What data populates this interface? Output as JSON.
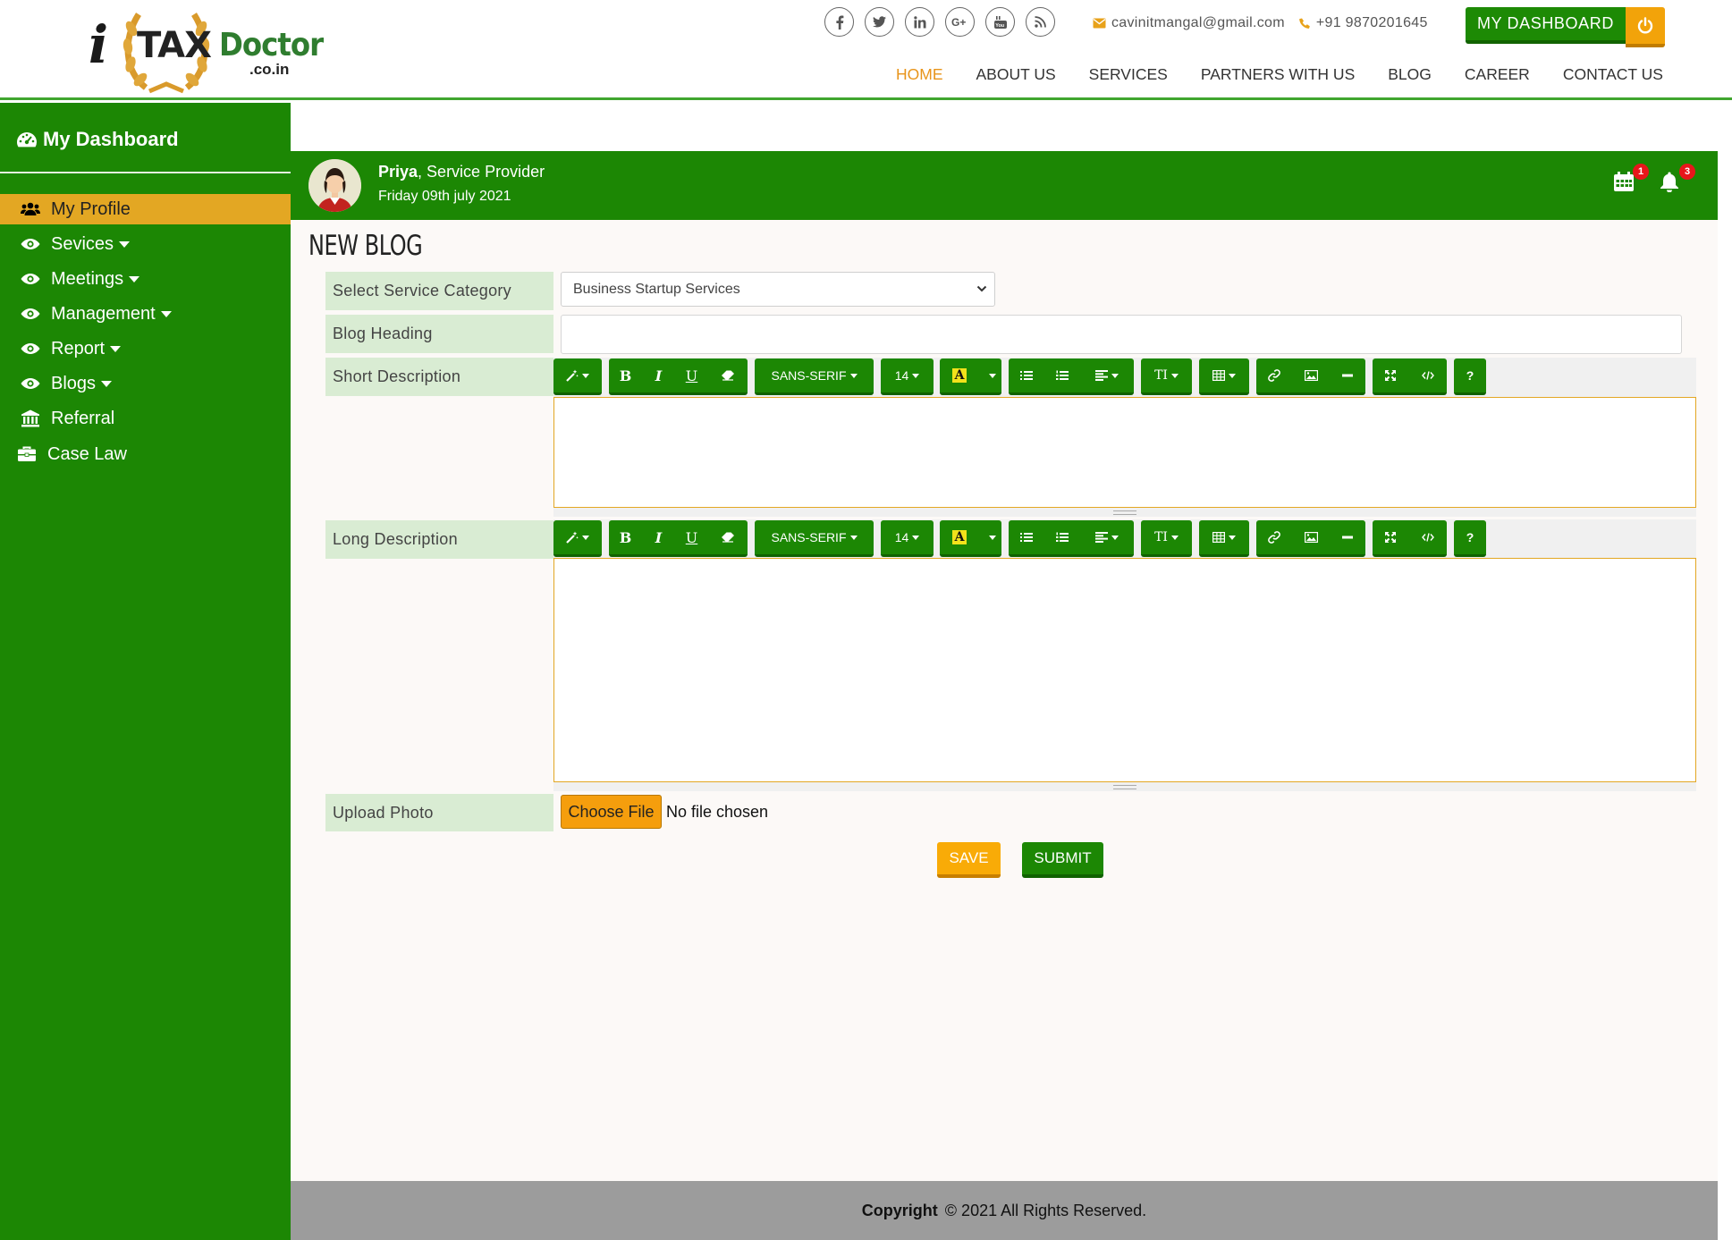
{
  "brand": {
    "i": "i",
    "tax": "TAX",
    "doctor": "Doctor",
    "domain": ".co.in"
  },
  "header": {
    "socials": [
      {
        "name": "facebook-icon",
        "glyph": "f"
      },
      {
        "name": "twitter-icon",
        "glyph": "t"
      },
      {
        "name": "linkedin-icon",
        "glyph": "in"
      },
      {
        "name": "google-plus-icon",
        "glyph": "G+"
      },
      {
        "name": "youtube-icon",
        "glyph": "You"
      },
      {
        "name": "rss-icon",
        "glyph": "rss"
      }
    ],
    "email": "cavinitmangal@gmail.com",
    "phone": "+91 9870201645",
    "dashboard_label": "MY DASHBOARD",
    "nav": [
      "HOME",
      "ABOUT US",
      "SERVICES",
      "PARTNERS WITH US",
      "BLOG",
      "CAREER",
      "CONTACT US"
    ],
    "active_nav": "HOME"
  },
  "sidebar": {
    "title": "My Dashboard",
    "items": [
      {
        "label": "My Profile",
        "icon": "users-icon",
        "active": true
      },
      {
        "label": "Sevices",
        "icon": "eye-icon",
        "dropdown": true
      },
      {
        "label": "Meetings",
        "icon": "eye-icon",
        "dropdown": true
      },
      {
        "label": "Management",
        "icon": "eye-icon",
        "dropdown": true
      },
      {
        "label": "Report",
        "icon": "eye-icon",
        "dropdown": true
      },
      {
        "label": "Blogs",
        "icon": "eye-icon",
        "dropdown": true
      },
      {
        "label": "Referral",
        "icon": "bank-icon"
      },
      {
        "label": "Case Law",
        "icon": "briefcase-icon"
      }
    ]
  },
  "user": {
    "name": "Priya",
    "role": ", Service Provider",
    "date": "Friday 09th july 2021",
    "calendar_count": "1",
    "bell_count": "3"
  },
  "form": {
    "title": "NEW BLOG",
    "category_label": "Select Service Category",
    "category_value": "Business Startup Services",
    "heading_label": "Blog Heading",
    "heading_value": "",
    "short_label": "Short Description",
    "long_label": "Long Description",
    "upload_label": "Upload Photo",
    "choose_file": "Choose File",
    "file_status": "No file chosen",
    "save": "SAVE",
    "submit": "SUBMIT"
  },
  "editor_toolbar": {
    "font_name": "SANS-SERIF",
    "font_size": "14",
    "bold": "B",
    "italic": "I",
    "underline": "U",
    "color_letter": "A",
    "text_height": "TI",
    "help": "?"
  },
  "footer": {
    "copyright_label": "Copyright",
    "copyright_text": "© 2021 All Rights Reserved."
  },
  "colors": {
    "green": "#1c8704",
    "orange": "#e3a723",
    "label_bg": "#d9ecd3",
    "footer": "#9c9c9c"
  }
}
